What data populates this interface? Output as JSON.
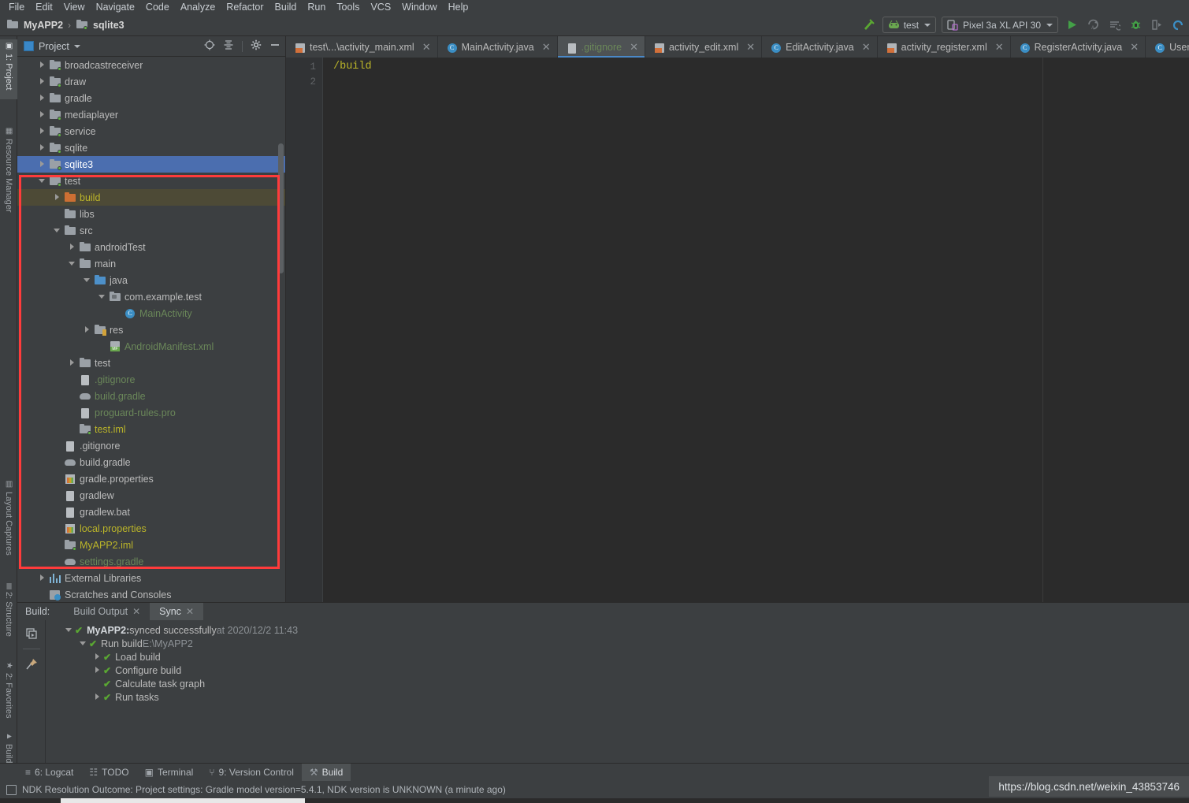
{
  "menu": {
    "items": [
      "File",
      "Edit",
      "View",
      "Navigate",
      "Code",
      "Analyze",
      "Refactor",
      "Build",
      "Run",
      "Tools",
      "VCS",
      "Window",
      "Help"
    ]
  },
  "toolbar": {
    "breadcrumb": [
      "MyAPP2",
      "sqlite3"
    ],
    "separator": "›",
    "run_config": "test",
    "device": "Pixel 3a XL API 30",
    "icons": [
      "build-hammer-icon",
      "run-icon",
      "apply-changes-icon",
      "apply-code-changes-icon",
      "debug-icon",
      "run-with-profiler-icon",
      "sync-gradle-icon"
    ]
  },
  "left_strip": {
    "tabs": [
      {
        "label": "1: Project",
        "active": true,
        "icon": "project-icon"
      },
      {
        "label": "Resource Manager",
        "active": false,
        "icon": "resource-manager-icon"
      },
      {
        "label": "Layout Captures",
        "active": false,
        "icon": "layout-captures-icon"
      },
      {
        "label": "2: Structure",
        "active": false,
        "icon": "structure-icon"
      },
      {
        "label": "2: Favorites",
        "active": false,
        "icon": "favorites-star-icon"
      },
      {
        "label": "Build Variants",
        "active": false,
        "icon": "build-variants-icon"
      }
    ]
  },
  "project_panel": {
    "title": "Project",
    "header_icons": [
      "locate-target-icon",
      "collapse-all-icon",
      "gear-icon",
      "minimize-icon"
    ],
    "tree": [
      {
        "label": "broadcastreceiver",
        "indent": 1,
        "arrow": "right",
        "icon": "module-folder",
        "color": "grey"
      },
      {
        "label": "draw",
        "indent": 1,
        "arrow": "right",
        "icon": "module-folder",
        "color": "grey"
      },
      {
        "label": "gradle",
        "indent": 1,
        "arrow": "right",
        "icon": "folder",
        "color": "grey"
      },
      {
        "label": "mediaplayer",
        "indent": 1,
        "arrow": "right",
        "icon": "module-folder",
        "color": "grey"
      },
      {
        "label": "service",
        "indent": 1,
        "arrow": "right",
        "icon": "module-folder",
        "color": "grey"
      },
      {
        "label": "sqlite",
        "indent": 1,
        "arrow": "right",
        "icon": "module-folder",
        "color": "grey"
      },
      {
        "label": "sqlite3",
        "indent": 1,
        "arrow": "right",
        "icon": "module-folder",
        "color": "grey",
        "state": "selected"
      },
      {
        "label": "test",
        "indent": 1,
        "arrow": "down",
        "icon": "module-folder",
        "color": "grey"
      },
      {
        "label": "build",
        "indent": 2,
        "arrow": "right",
        "icon": "folder-orange",
        "color": "yellow",
        "state": "hovered"
      },
      {
        "label": "libs",
        "indent": 2,
        "arrow": "none",
        "icon": "folder",
        "color": "grey"
      },
      {
        "label": "src",
        "indent": 2,
        "arrow": "down",
        "icon": "folder",
        "color": "grey"
      },
      {
        "label": "androidTest",
        "indent": 3,
        "arrow": "right",
        "icon": "folder",
        "color": "grey"
      },
      {
        "label": "main",
        "indent": 3,
        "arrow": "down",
        "icon": "folder",
        "color": "grey"
      },
      {
        "label": "java",
        "indent": 4,
        "arrow": "down",
        "icon": "folder-blue",
        "color": "grey"
      },
      {
        "label": "com.example.test",
        "indent": 5,
        "arrow": "down",
        "icon": "package-folder",
        "color": "grey"
      },
      {
        "label": "MainActivity",
        "indent": 6,
        "arrow": "none",
        "icon": "java-class-icon",
        "color": "green"
      },
      {
        "label": "res",
        "indent": 4,
        "arrow": "right",
        "icon": "res-folder",
        "color": "grey"
      },
      {
        "label": "AndroidManifest.xml",
        "indent": 5,
        "arrow": "none",
        "icon": "manifest-icon",
        "color": "green"
      },
      {
        "label": "test",
        "indent": 3,
        "arrow": "right",
        "icon": "folder",
        "color": "grey"
      },
      {
        "label": ".gitignore",
        "indent": 3,
        "arrow": "none",
        "icon": "file-icon",
        "color": "green"
      },
      {
        "label": "build.gradle",
        "indent": 3,
        "arrow": "none",
        "icon": "gradle-icon",
        "color": "green"
      },
      {
        "label": "proguard-rules.pro",
        "indent": 3,
        "arrow": "none",
        "icon": "file-icon",
        "color": "green"
      },
      {
        "label": "test.iml",
        "indent": 3,
        "arrow": "none",
        "icon": "iml-icon",
        "color": "yellow"
      },
      {
        "label": ".gitignore",
        "indent": 2,
        "arrow": "none",
        "icon": "file-icon",
        "color": "grey"
      },
      {
        "label": "build.gradle",
        "indent": 2,
        "arrow": "none",
        "icon": "gradle-icon",
        "color": "grey"
      },
      {
        "label": "gradle.properties",
        "indent": 2,
        "arrow": "none",
        "icon": "properties-icon",
        "color": "grey"
      },
      {
        "label": "gradlew",
        "indent": 2,
        "arrow": "none",
        "icon": "file-icon",
        "color": "grey"
      },
      {
        "label": "gradlew.bat",
        "indent": 2,
        "arrow": "none",
        "icon": "file-icon",
        "color": "grey"
      },
      {
        "label": "local.properties",
        "indent": 2,
        "arrow": "none",
        "icon": "properties-icon",
        "color": "yellow"
      },
      {
        "label": "MyAPP2.iml",
        "indent": 2,
        "arrow": "none",
        "icon": "iml-icon",
        "color": "yellow"
      },
      {
        "label": "settings.gradle",
        "indent": 2,
        "arrow": "none",
        "icon": "gradle-icon",
        "color": "green"
      },
      {
        "label": "External Libraries",
        "indent": 1,
        "arrow": "right",
        "icon": "libraries-icon",
        "color": "grey"
      },
      {
        "label": "Scratches and Consoles",
        "indent": 1,
        "arrow": "none",
        "icon": "scratches-icon",
        "color": "grey"
      }
    ]
  },
  "editor": {
    "tabs": [
      {
        "label": "test\\...\\activity_main.xml",
        "icon": "xml-layout-icon",
        "active": false,
        "color": "grey"
      },
      {
        "label": "MainActivity.java",
        "icon": "java-class-icon",
        "active": false,
        "color": "grey"
      },
      {
        "label": ".gitignore",
        "icon": "file-icon",
        "active": true,
        "color": "green"
      },
      {
        "label": "activity_edit.xml",
        "icon": "xml-layout-icon",
        "active": false,
        "color": "grey"
      },
      {
        "label": "EditActivity.java",
        "icon": "java-class-icon",
        "active": false,
        "color": "grey"
      },
      {
        "label": "activity_register.xml",
        "icon": "xml-layout-icon",
        "active": false,
        "color": "grey"
      },
      {
        "label": "RegisterActivity.java",
        "icon": "java-class-icon",
        "active": false,
        "color": "grey"
      },
      {
        "label": "User.java",
        "icon": "java-class-icon",
        "active": false,
        "color": "grey"
      }
    ],
    "line_numbers": [
      "1",
      "2"
    ],
    "code_lines": [
      "/build"
    ],
    "code_color": "#bbb529"
  },
  "build_panel": {
    "label": "Build:",
    "tabs": [
      {
        "label": "Build Output",
        "active": false
      },
      {
        "label": "Sync",
        "active": true
      }
    ],
    "sidebar_icons": [
      "restart-icon",
      "pin-icon"
    ],
    "rows": [
      {
        "arrow": "down",
        "check": true,
        "indent": 0,
        "bold": "MyAPP2:",
        "text": " synced successfully",
        "dim": " at 2020/12/2 11:43"
      },
      {
        "arrow": "down",
        "check": true,
        "indent": 1,
        "bold": "",
        "text": "Run build",
        "dim": " E:\\MyAPP2"
      },
      {
        "arrow": "right",
        "check": true,
        "indent": 2,
        "bold": "",
        "text": "Load build",
        "dim": ""
      },
      {
        "arrow": "right",
        "check": true,
        "indent": 2,
        "bold": "",
        "text": "Configure build",
        "dim": ""
      },
      {
        "arrow": "none",
        "check": true,
        "indent": 2,
        "bold": "",
        "text": "Calculate task graph",
        "dim": ""
      },
      {
        "arrow": "right",
        "check": true,
        "indent": 2,
        "bold": "",
        "text": "Run tasks",
        "dim": ""
      }
    ]
  },
  "bottom_bar": {
    "buttons": [
      {
        "label": "6: Logcat",
        "icon": "logcat-icon",
        "active": false
      },
      {
        "label": "TODO",
        "icon": "todo-icon",
        "active": false
      },
      {
        "label": "Terminal",
        "icon": "terminal-icon",
        "active": false
      },
      {
        "label": "9: Version Control",
        "icon": "version-control-icon",
        "active": false
      },
      {
        "label": "Build",
        "icon": "build-hammer-icon",
        "active": true
      }
    ]
  },
  "status_bar": {
    "message": "NDK Resolution Outcome: Project settings: Gradle model version=5.4.1, NDK version is UNKNOWN (a minute ago)",
    "watermark_url": "https://blog.csdn.net/weixin_43853746"
  },
  "colors": {
    "background": "#3c3f41",
    "editor_background": "#2b2b2b",
    "selection_blue": "#4b6eaf",
    "hover_olive": "#4d4a36",
    "accent_blue": "#4a88c7",
    "success_green": "#5aa832",
    "annotation_red": "#ff3b3b",
    "text_green": "#6a8759",
    "text_yellow": "#bbb529"
  }
}
